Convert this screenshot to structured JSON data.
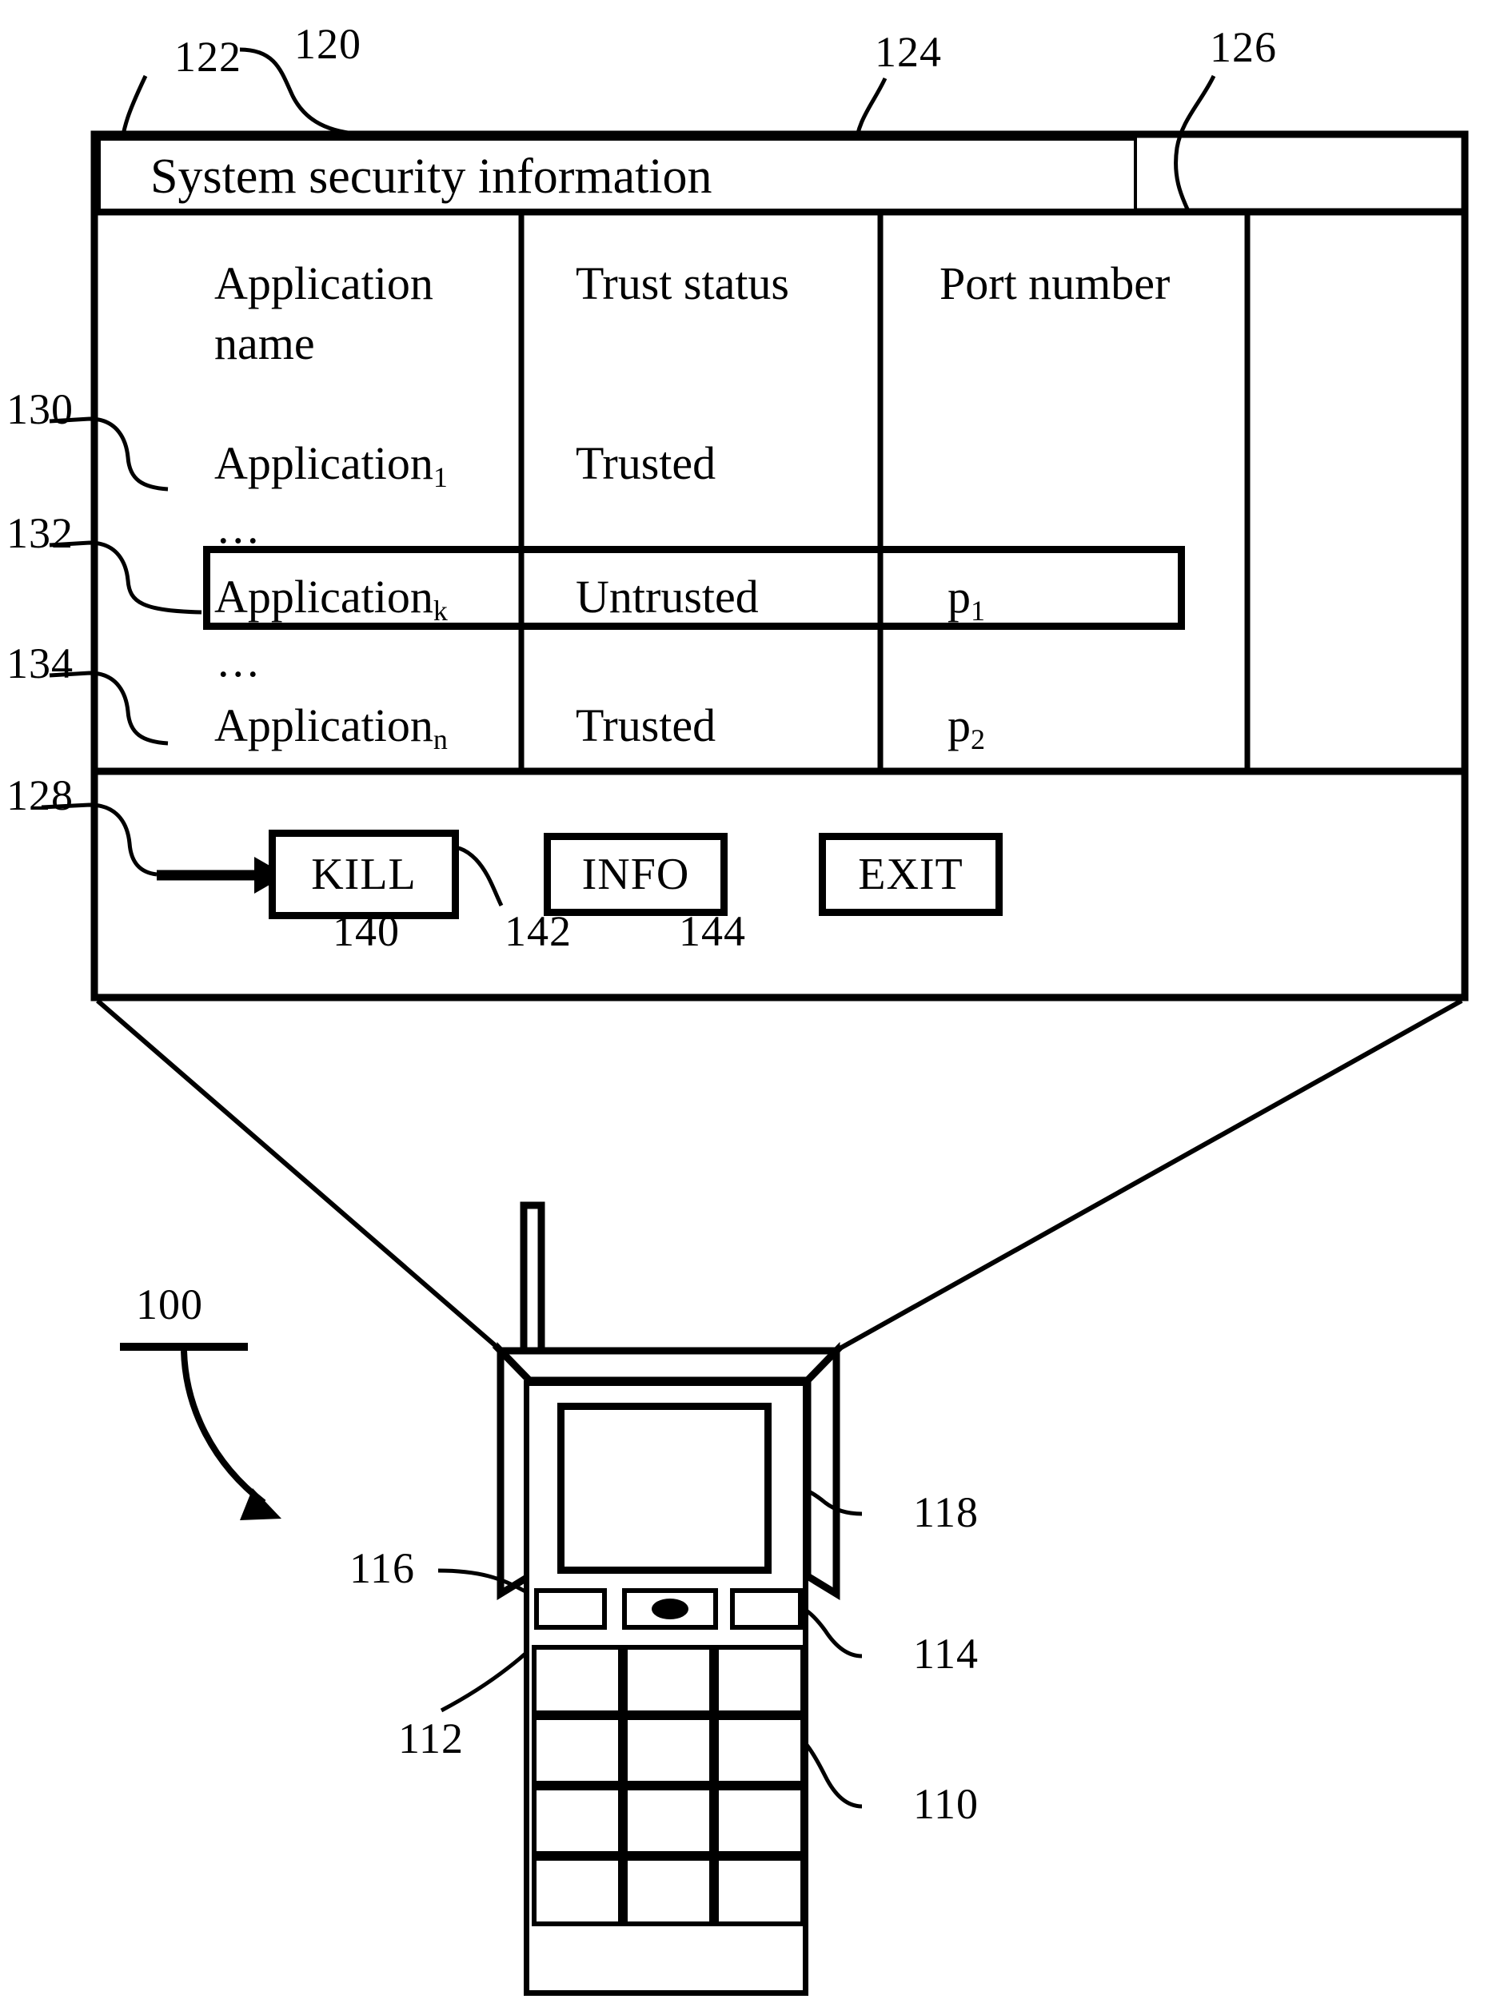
{
  "figure": {
    "title_bar": {
      "label": "System security information"
    },
    "table": {
      "columns": [
        {
          "header_line1": "Application",
          "header_line2": "name"
        },
        {
          "header_line1": "Trust status",
          "header_line2": ""
        },
        {
          "header_line1": "Port number",
          "header_line2": ""
        },
        {
          "header_line1": "",
          "header_line2": ""
        }
      ],
      "rows": [
        {
          "app_base": "Application",
          "app_sub": "1",
          "trust": "Trusted",
          "port_base": "",
          "port_sub": "",
          "selected": false,
          "leading_ellipsis": false
        },
        {
          "app_base": "Application",
          "app_sub": "k",
          "trust": "Untrusted",
          "port_base": "p",
          "port_sub": "1",
          "selected": true,
          "leading_ellipsis": true
        },
        {
          "app_base": "Application",
          "app_sub": "n",
          "trust": "Trusted",
          "port_base": "p",
          "port_sub": "2",
          "selected": false,
          "leading_ellipsis": true
        }
      ],
      "ellipsis_glyph": "..."
    },
    "buttons": [
      {
        "label": "KILL"
      },
      {
        "label": "INFO"
      },
      {
        "label": "EXIT"
      }
    ],
    "reference_numerals": {
      "n100": "100",
      "n110": "110",
      "n112": "112",
      "n114": "114",
      "n116": "116",
      "n118": "118",
      "n120": "120",
      "n122": "122",
      "n124": "124",
      "n126": "126",
      "n128": "128",
      "n130": "130",
      "n132": "132",
      "n134": "134",
      "n140": "140",
      "n142": "142",
      "n144": "144"
    },
    "colors": {
      "ink": "#000000",
      "paper": "#ffffff"
    }
  }
}
